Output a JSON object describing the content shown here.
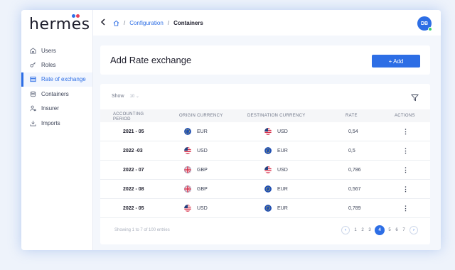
{
  "logo": {
    "text_before": "herm",
    "text_m": "—",
    "text_after": "s",
    "full": "hermes"
  },
  "nav": [
    {
      "label": "Users",
      "icon": "building-icon",
      "active": false
    },
    {
      "label": "Roles",
      "icon": "key-icon",
      "active": false
    },
    {
      "label": "Rate of exchange",
      "icon": "table-icon",
      "active": true
    },
    {
      "label": "Containers",
      "icon": "database-icon",
      "active": false
    },
    {
      "label": "Insurer",
      "icon": "user-lock-icon",
      "active": false
    },
    {
      "label": "Imports",
      "icon": "download-icon",
      "active": false
    }
  ],
  "breadcrumb": {
    "section": "Configuration",
    "current": "Containers"
  },
  "user": {
    "initials": "DB"
  },
  "header": {
    "title": "Add Rate exchange",
    "add_label": "+ Add"
  },
  "table": {
    "show_label": "Show",
    "show_value": "10",
    "columns": [
      "ACCOUNTING PERIOD",
      "ORIGIN CURRENCY",
      "DESTINATION CURRENCY",
      "RATE",
      "ACTIONS"
    ],
    "rows": [
      {
        "period": "2021 - 05",
        "origin": "EUR",
        "origin_flag": "eu-flag-icon",
        "destination": "USD",
        "destination_flag": "us-flag-icon",
        "rate": "0,54"
      },
      {
        "period": "2022 -03",
        "origin": "USD",
        "origin_flag": "us-flag-icon",
        "destination": "EUR",
        "destination_flag": "eu-flag-icon",
        "rate": "0,5"
      },
      {
        "period": "2022 - 07",
        "origin": "GBP",
        "origin_flag": "uk-flag-icon",
        "destination": "USD",
        "destination_flag": "us-flag-icon",
        "rate": "0,786"
      },
      {
        "period": "2022 - 08",
        "origin": "GBP",
        "origin_flag": "uk-flag-icon",
        "destination": "EUR",
        "destination_flag": "eu-flag-icon",
        "rate": "0,567"
      },
      {
        "period": "2022 - 05",
        "origin": "USD",
        "origin_flag": "us-flag-icon",
        "destination": "EUR",
        "destination_flag": "eu-flag-icon",
        "rate": "0,789"
      }
    ],
    "footer": "Showing 1 to 7 of 100 entries"
  },
  "pagination": {
    "pages": [
      "1",
      "2",
      "3",
      "4",
      "5",
      "6",
      "7"
    ],
    "current": "4"
  },
  "colors": {
    "accent": "#2d6ee5",
    "online": "#3ccf6b"
  }
}
